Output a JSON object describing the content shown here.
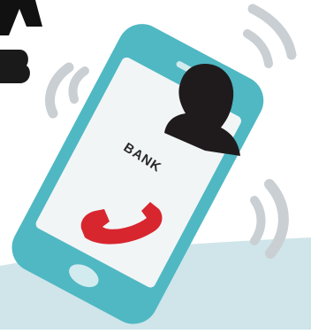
{
  "caller": {
    "name": "BANK"
  },
  "icons": {
    "phone": "smartphone-icon",
    "caller": "caller-silhouette-icon",
    "hangup": "phone-hangup-icon",
    "ringing": "ringing-waves-icon"
  },
  "colors": {
    "phone_body": "#4fb8c3",
    "screen": "#f2f5f6",
    "silhouette": "#1f1b1c",
    "hangup": "#d8262f",
    "waves": "#c9cfd3",
    "home_button": "#d2ebef",
    "shadow_band": "#c4dde3"
  }
}
